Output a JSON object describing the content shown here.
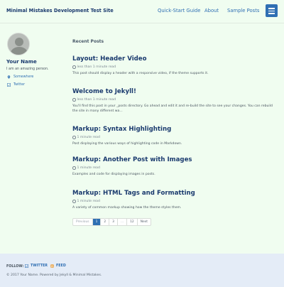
{
  "header": {
    "site_title": "Minimal Mistakes Development Test Site",
    "nav": [
      "Quick-Start Guide",
      "About",
      "Sample Posts"
    ]
  },
  "sidebar": {
    "author_name": "Your Name",
    "bio": "I am an amazing person.",
    "location": "Somewhere",
    "twitter": "Twitter"
  },
  "main": {
    "heading": "Recent Posts",
    "posts": [
      {
        "title": "Layout: Header Video",
        "meta": "less than 1 minute read",
        "excerpt": "This post should display a header with a responsive video, if the theme supports it."
      },
      {
        "title": "Welcome to Jekyll!",
        "meta": "less than 1 minute read",
        "excerpt": "You'll find this post in your _posts directory. Go ahead and edit it and re-build the site to see your changes. You can rebuild the site in many different wa..."
      },
      {
        "title": "Markup: Syntax Highlighting",
        "meta": "1 minute read",
        "excerpt": "Post displaying the various ways of highlighting code in Markdown."
      },
      {
        "title": "Markup: Another Post with Images",
        "meta": "1 minute read",
        "excerpt": "Examples and code for displaying images in posts."
      },
      {
        "title": "Markup: HTML Tags and Formatting",
        "meta": "1 minute read",
        "excerpt": "A variety of common markup showing how the theme styles them."
      }
    ],
    "pagination": [
      "Previous",
      "1",
      "2",
      "3",
      "...",
      "12",
      "Next"
    ]
  },
  "footer": {
    "follow_label": "FOLLOW:",
    "twitter": "TWITTER",
    "feed": "FEED",
    "copyright": "© 2017 Your Name. Powered by Jekyll & Minimal Mistakes."
  },
  "colors": {
    "background": "#f0fdf0",
    "accent": "#2f6fb3",
    "title": "#1a3a6e",
    "footer_bg": "#e4ecf7"
  }
}
